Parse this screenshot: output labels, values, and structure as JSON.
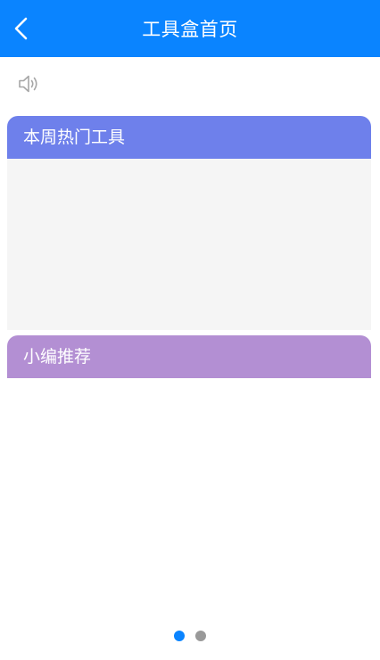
{
  "header": {
    "title": "工具盒首页",
    "back_icon": "chevron-left-icon",
    "background_color": "#0a84ff"
  },
  "announcement": {
    "icon": "speaker-icon"
  },
  "sections": {
    "hot_tools": {
      "title": "本周热门工具",
      "color": "#6e80eb"
    },
    "editor_picks": {
      "title": "小编推荐",
      "color": "#b38fd3"
    }
  },
  "pager": {
    "page_count": 2,
    "active_index": 0,
    "active_color": "#0a84ff",
    "inactive_color": "#999999"
  }
}
